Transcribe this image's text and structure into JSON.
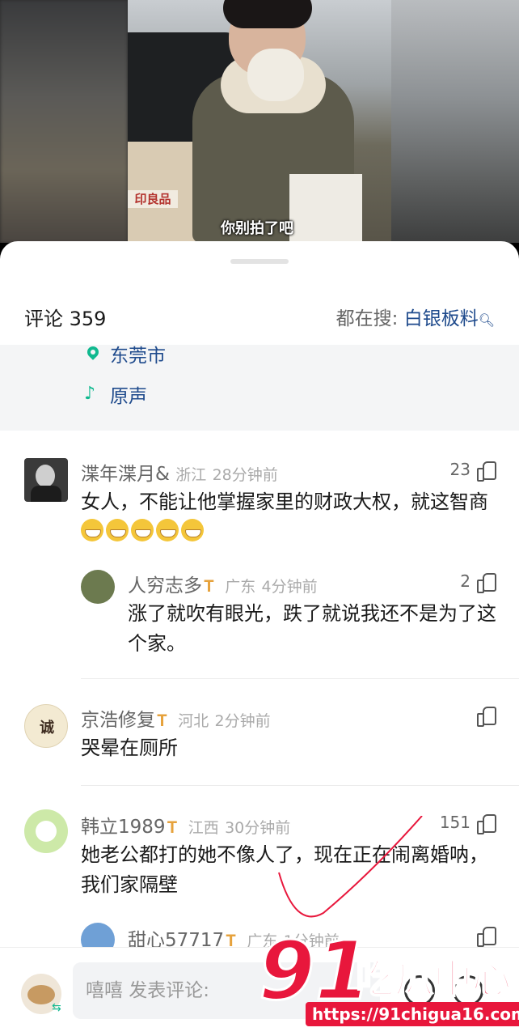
{
  "video": {
    "subtitle": "你别拍了吧",
    "bag_label": "印良品"
  },
  "header": {
    "comment_count": "评论 359",
    "hot_search_prefix": "都在搜:",
    "hot_search_keyword": "白银板料"
  },
  "meta": {
    "location": "东莞市",
    "audio": "原声"
  },
  "comments": [
    {
      "user": "渫年渫月&",
      "region": "浙江",
      "time": "28分钟前",
      "likes": "23",
      "text": "女人，不能让他掌握家里的财政大权，就这智商"
    },
    {
      "user": "人穷志多",
      "region": "广东",
      "time": "4分钟前",
      "likes": "2",
      "text": "涨了就吹有眼光，跌了就说我还不是为了这个家。"
    },
    {
      "user": "京浩修复",
      "region": "河北",
      "time": "2分钟前",
      "likes": "",
      "text": "哭晕在厕所"
    },
    {
      "user": "韩立1989",
      "region": "江西",
      "time": "30分钟前",
      "likes": "151",
      "text": "她老公都打的她不像人了，现在正在闹离婚呐，我们家隔壁"
    },
    {
      "user": "甜心57717",
      "region": "广东",
      "time": "1分钟前",
      "likes": "",
      "text": ""
    }
  ],
  "input": {
    "placeholder": "嘻嘻 发表评论:"
  },
  "watermark": {
    "number": "91",
    "brand": "吃瓜中心",
    "url": "https://91chigua16.com"
  },
  "colors": {
    "accent_green": "#10b98f",
    "link_blue": "#1e4a8c",
    "badge_gold": "#e6a23c",
    "watermark_red": "#e8173c"
  }
}
